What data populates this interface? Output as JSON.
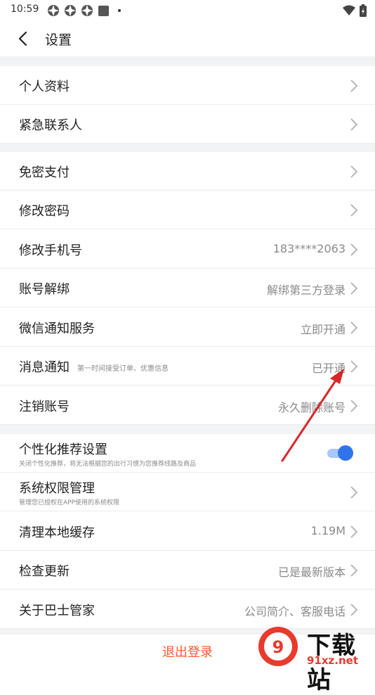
{
  "status_bar": {
    "time": "10:59"
  },
  "header": {
    "title": "设置"
  },
  "groups": [
    {
      "items": [
        {
          "label": "个人资料",
          "value": ""
        },
        {
          "label": "紧急联系人",
          "value": ""
        }
      ]
    },
    {
      "items": [
        {
          "label": "免密支付",
          "value": ""
        },
        {
          "label": "修改密码",
          "value": ""
        },
        {
          "label": "修改手机号",
          "value": "183****2063"
        },
        {
          "label": "账号解绑",
          "value": "解绑第三方登录"
        },
        {
          "label": "微信通知服务",
          "value": "立即开通"
        },
        {
          "label": "消息通知",
          "sublabel": "第一时间接受订单、优惠信息",
          "value": "已开通"
        },
        {
          "label": "注销账号",
          "value": "永久删除账号"
        }
      ]
    },
    {
      "items": [
        {
          "label": "个性化推荐设置",
          "sublabel": "关闭个性化推荐，将无法根据您的出行习惯为您推荐线路及商品",
          "toggle_on": true
        },
        {
          "label": "系统权限管理",
          "sublabel": "管理您已授权在APP使用的系统权限",
          "value": ""
        },
        {
          "label": "清理本地缓存",
          "value": "1.19M"
        },
        {
          "label": "检查更新",
          "value": "已是最新版本"
        },
        {
          "label": "关于巴士管家",
          "value": "公司简介、客服电话"
        }
      ]
    }
  ],
  "footer": {
    "logout_label": "退出登录"
  },
  "watermark": {
    "brand": "下载站",
    "url": "91xz.net"
  },
  "colors": {
    "accent": "#2f74ea",
    "logout": "#ff5a2c",
    "annotation_arrow": "#d8262a",
    "separator_bg": "#f2f3f5"
  }
}
